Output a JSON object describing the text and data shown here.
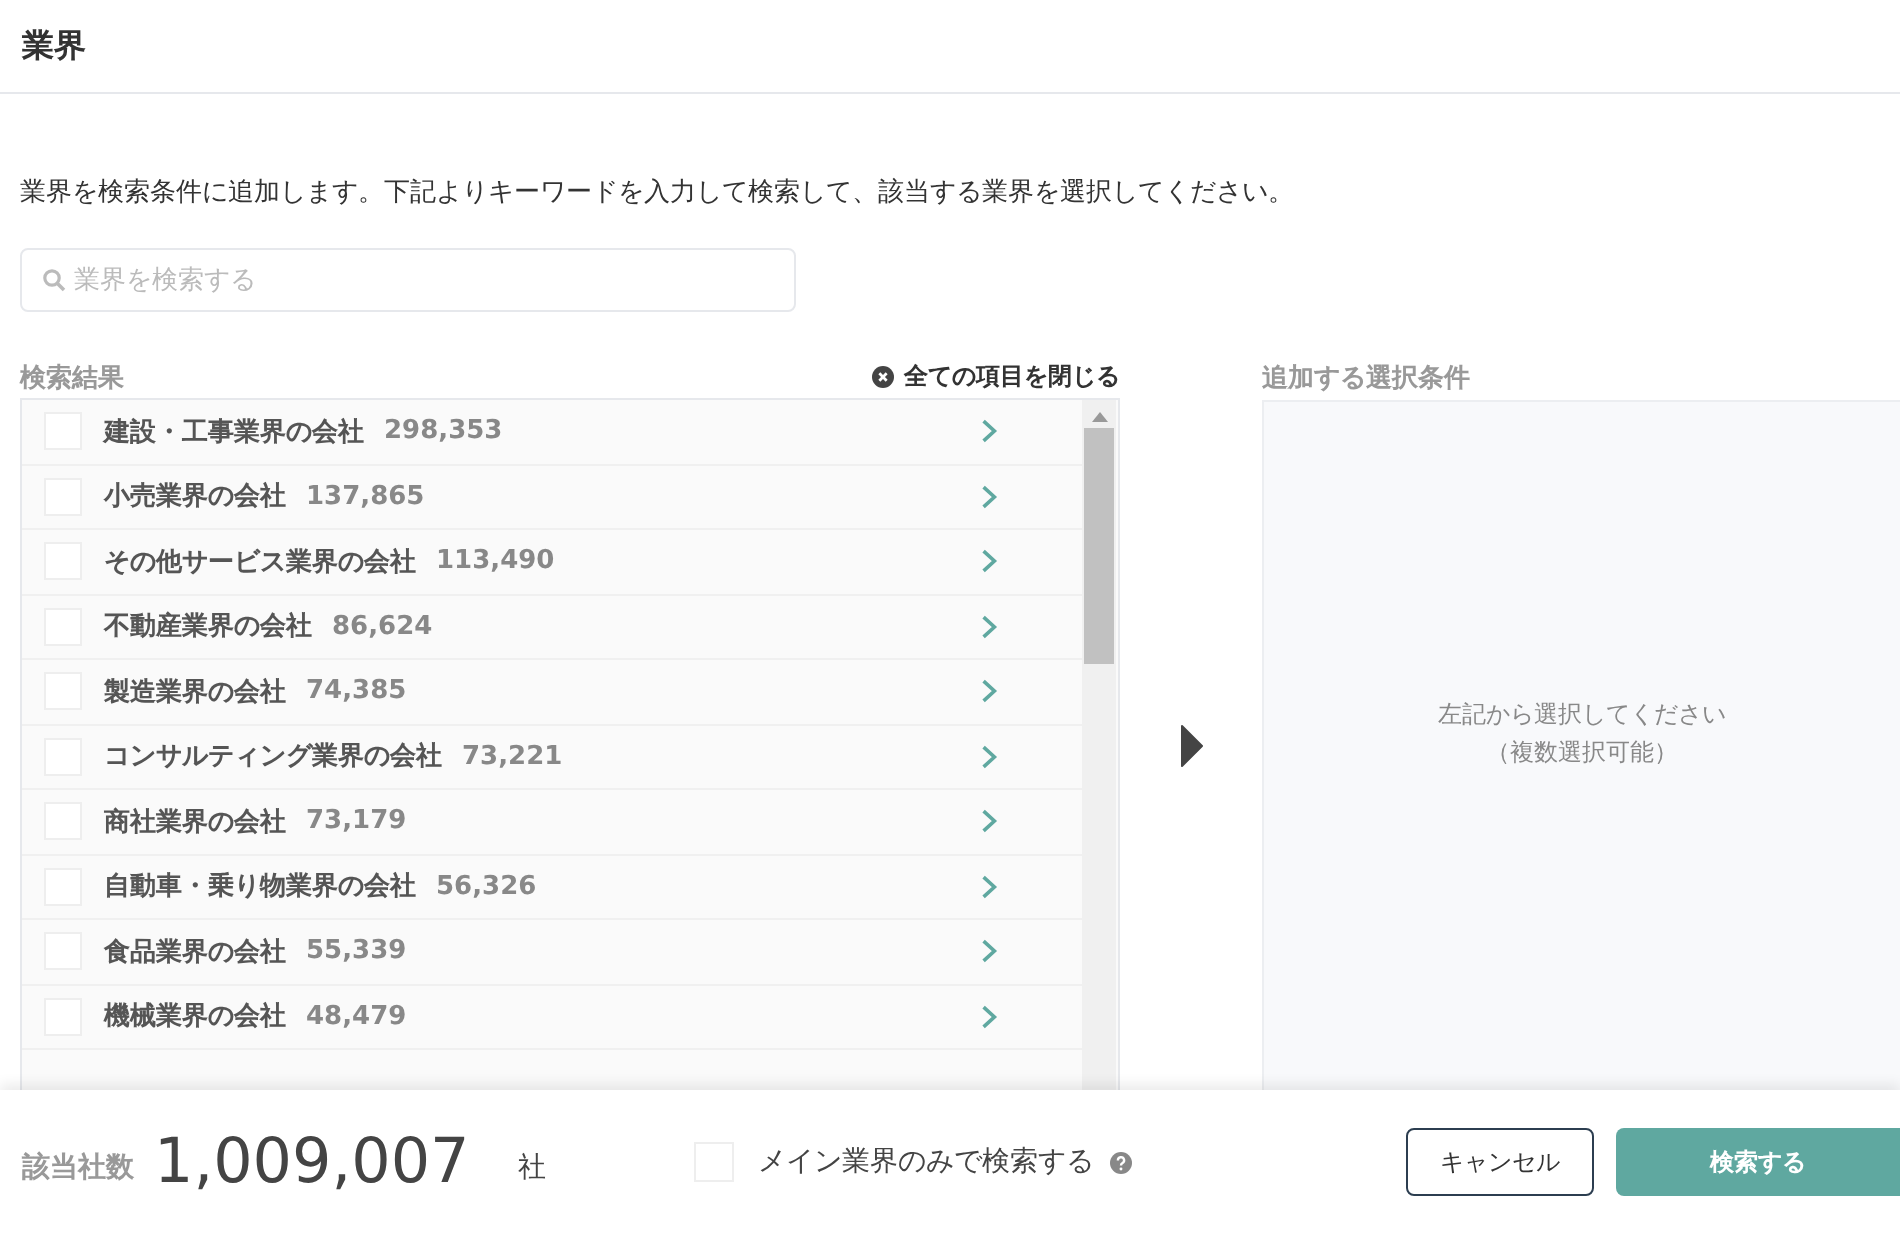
{
  "header": {
    "title": "業界"
  },
  "description": "業界を検索条件に追加します。下記よりキーワードを入力して検索して、該当する業界を選択してください。",
  "search": {
    "placeholder": "業界を検索する"
  },
  "results": {
    "heading": "検索結果",
    "collapse_all": "全ての項目を閉じる",
    "items": [
      {
        "name": "建設・工事業界の会社",
        "count": "298,353",
        "checked": false
      },
      {
        "name": "小売業界の会社",
        "count": "137,865",
        "checked": false
      },
      {
        "name": "その他サービス業界の会社",
        "count": "113,490",
        "checked": false
      },
      {
        "name": "不動産業界の会社",
        "count": "86,624",
        "checked": false
      },
      {
        "name": "製造業界の会社",
        "count": "74,385",
        "checked": false
      },
      {
        "name": "コンサルティング業界の会社",
        "count": "73,221",
        "checked": false
      },
      {
        "name": "商社業界の会社",
        "count": "73,179",
        "checked": false
      },
      {
        "name": "自動車・乗り物業界の会社",
        "count": "56,326",
        "checked": false
      },
      {
        "name": "食品業界の会社",
        "count": "55,339",
        "checked": false
      },
      {
        "name": "機械業界の会社",
        "count": "48,479",
        "checked": false
      }
    ]
  },
  "selected_panel": {
    "heading": "追加する選択条件",
    "empty_lines": [
      "左記から選択してください",
      "（複数選択可能）"
    ]
  },
  "footer": {
    "count_label": "該当社数",
    "count": "1,009,007",
    "unit": "社",
    "main_only": {
      "label": "メイン業界のみで検索する",
      "checked": false
    },
    "cancel": "キャンセル",
    "submit": "検索する"
  }
}
